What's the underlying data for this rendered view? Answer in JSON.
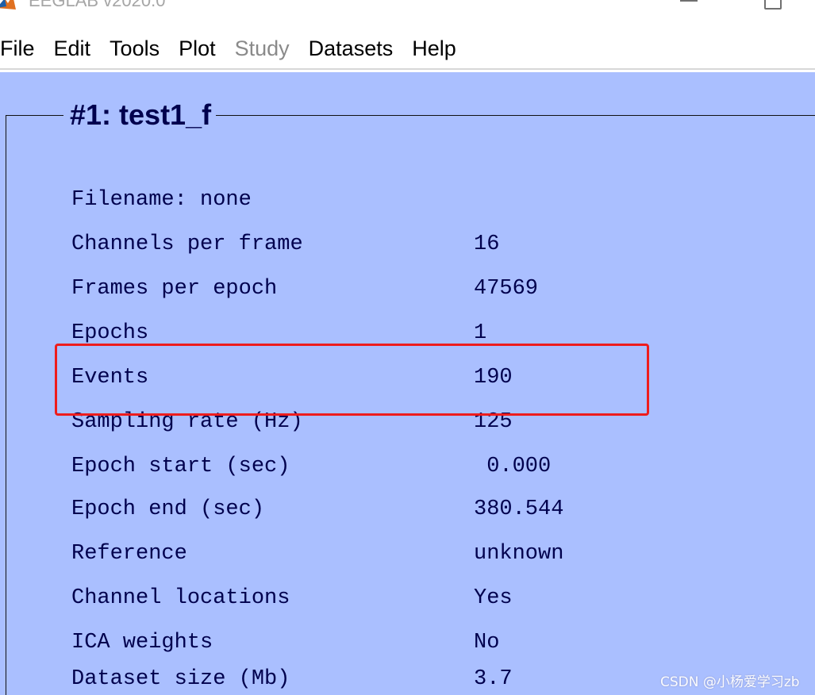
{
  "window": {
    "title": "EEGLAB v2020.0"
  },
  "menu": {
    "items": [
      {
        "label": "File",
        "enabled": true
      },
      {
        "label": "Edit",
        "enabled": true
      },
      {
        "label": "Tools",
        "enabled": true
      },
      {
        "label": "Plot",
        "enabled": true
      },
      {
        "label": "Study",
        "enabled": false
      },
      {
        "label": "Datasets",
        "enabled": true
      },
      {
        "label": "Help",
        "enabled": true
      }
    ]
  },
  "dataset": {
    "title": "#1: test1_f",
    "rows": [
      {
        "label": "Filename: none",
        "value": ""
      },
      {
        "label": "Channels per frame",
        "value": "16"
      },
      {
        "label": "Frames per epoch",
        "value": "47569"
      },
      {
        "label": "Epochs",
        "value": "1"
      },
      {
        "label": "Events",
        "value": "190"
      },
      {
        "label": "Sampling rate (Hz)",
        "value": "125"
      },
      {
        "label": "Epoch start (sec)",
        "value": " 0.000"
      },
      {
        "label": "Epoch end (sec)",
        "value": "380.544"
      },
      {
        "label": "Reference",
        "value": "unknown"
      },
      {
        "label": "Channel locations",
        "value": "Yes"
      },
      {
        "label": "ICA weights",
        "value": "No"
      },
      {
        "label": "Dataset size (Mb)",
        "value": "3.7"
      }
    ]
  },
  "watermark": "CSDN @小杨爱学习zb",
  "colors": {
    "background": "#aabfff",
    "text": "#00004d",
    "highlight": "#ee1c1c",
    "disabled_menu": "#8a8a8a"
  }
}
